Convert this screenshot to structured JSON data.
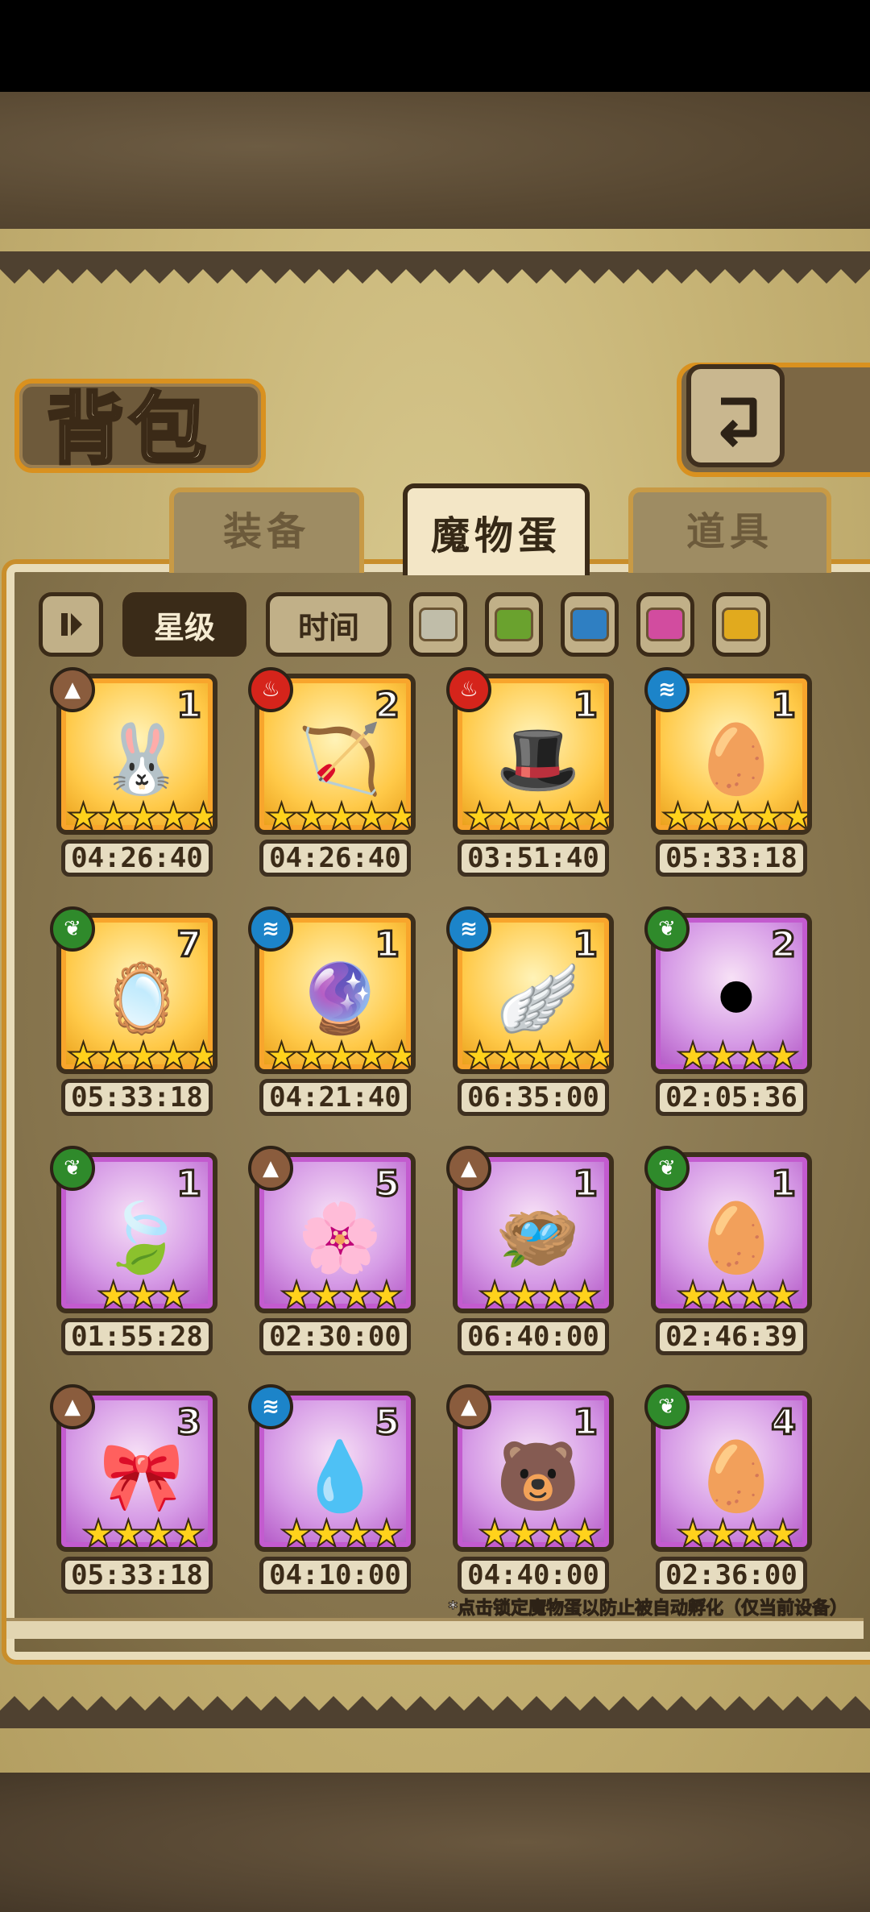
{
  "title": "背包",
  "tabs": [
    {
      "label": "装备",
      "active": false
    },
    {
      "label": "魔物蛋",
      "active": true
    },
    {
      "label": "道具",
      "active": false
    }
  ],
  "sort": {
    "toggle_icon": "sort-toggle-icon",
    "star": "星级",
    "time": "时间",
    "active": "star"
  },
  "color_filters": [
    "#c0bda9",
    "#6aa22e",
    "#2f7fc2",
    "#d24c9f",
    "#e1aa1e"
  ],
  "elements": {
    "earth": {
      "color": "#8a5c3d",
      "glyph": "▲"
    },
    "fire": {
      "color": "#d5241b",
      "glyph": "♨"
    },
    "water": {
      "color": "#1c84c9",
      "glyph": "≋"
    },
    "wood": {
      "color": "#2f8a2b",
      "glyph": "❦"
    }
  },
  "eggs": [
    {
      "element": "earth",
      "count": "1",
      "stars": 5,
      "frame": "gold",
      "timer": "04:26:40",
      "art": "🐰"
    },
    {
      "element": "fire",
      "count": "2",
      "stars": 5,
      "frame": "gold",
      "timer": "04:26:40",
      "art": "🏹"
    },
    {
      "element": "fire",
      "count": "1",
      "stars": 5,
      "frame": "gold",
      "timer": "03:51:40",
      "art": "🎩"
    },
    {
      "element": "water",
      "count": "1",
      "stars": 5,
      "frame": "gold",
      "timer": "05:33:18",
      "art": "🥚"
    },
    {
      "element": "wood",
      "count": "7",
      "stars": 5,
      "frame": "gold",
      "timer": "05:33:18",
      "art": "🪞"
    },
    {
      "element": "water",
      "count": "1",
      "stars": 5,
      "frame": "gold",
      "timer": "04:21:40",
      "art": "🔮"
    },
    {
      "element": "water",
      "count": "1",
      "stars": 5,
      "frame": "gold",
      "timer": "06:35:00",
      "art": "🪽"
    },
    {
      "element": "wood",
      "count": "2",
      "stars": 4,
      "frame": "purple",
      "timer": "02:05:36",
      "art": "⚫"
    },
    {
      "element": "wood",
      "count": "1",
      "stars": 3,
      "frame": "purple",
      "timer": "01:55:28",
      "art": "🍃"
    },
    {
      "element": "earth",
      "count": "5",
      "stars": 4,
      "frame": "purple",
      "timer": "02:30:00",
      "art": "🌸"
    },
    {
      "element": "earth",
      "count": "1",
      "stars": 4,
      "frame": "purple",
      "timer": "06:40:00",
      "art": "🪺"
    },
    {
      "element": "wood",
      "count": "1",
      "stars": 4,
      "frame": "purple",
      "timer": "02:46:39",
      "art": "🥚"
    },
    {
      "element": "earth",
      "count": "3",
      "stars": 4,
      "frame": "purple",
      "timer": "05:33:18",
      "art": "🎀"
    },
    {
      "element": "water",
      "count": "5",
      "stars": 4,
      "frame": "purple",
      "timer": "04:10:00",
      "art": "💧"
    },
    {
      "element": "earth",
      "count": "1",
      "stars": 4,
      "frame": "purple",
      "timer": "04:40:00",
      "art": "🐻"
    },
    {
      "element": "wood",
      "count": "4",
      "stars": 4,
      "frame": "purple",
      "timer": "02:36:00",
      "art": "🥚"
    }
  ],
  "footnote": "*点击锁定魔物蛋以防止被自动孵化（仅当前设备）"
}
